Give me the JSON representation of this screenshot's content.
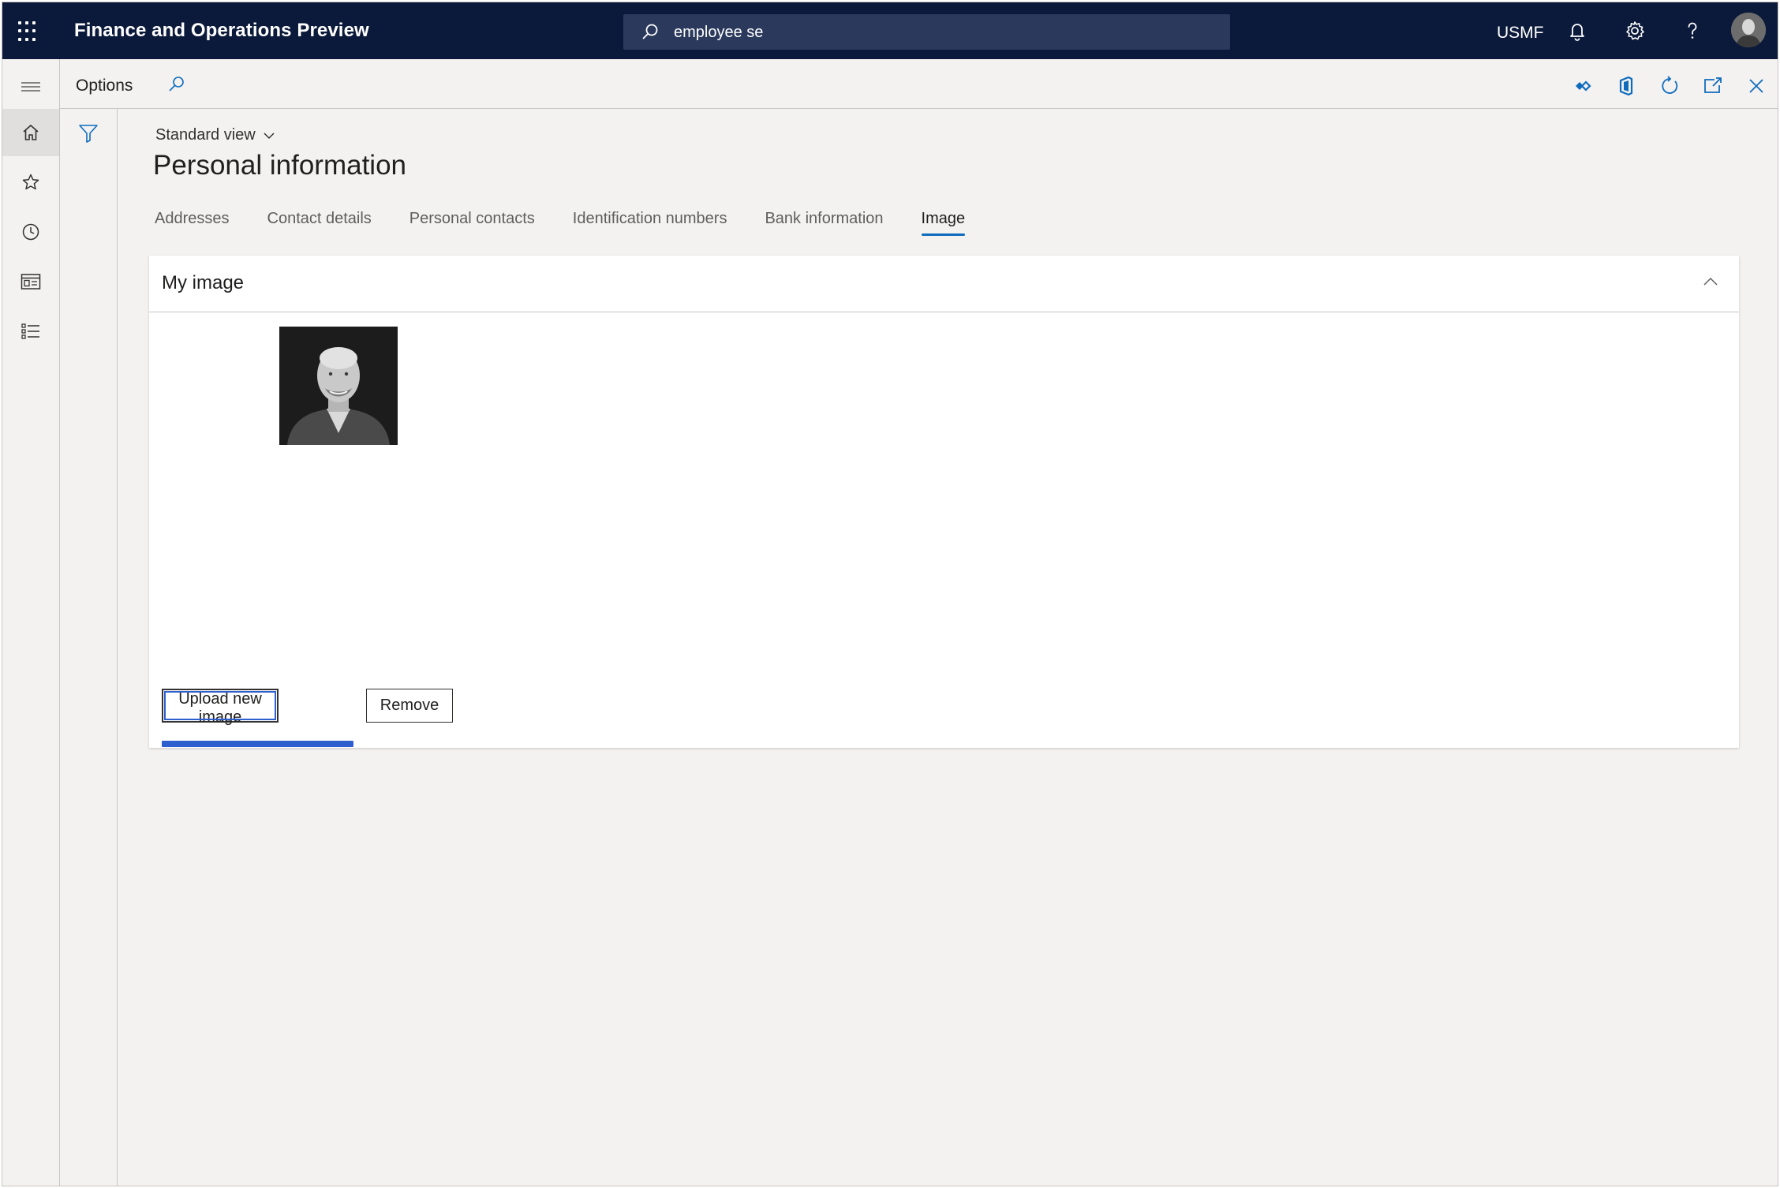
{
  "app": {
    "title": "Finance and Operations Preview"
  },
  "search": {
    "value": "employee se"
  },
  "topbar": {
    "company": "USMF"
  },
  "actionbar": {
    "options_label": "Options"
  },
  "view": {
    "label": "Standard view"
  },
  "page": {
    "title": "Personal information"
  },
  "tabs": [
    {
      "label": "Addresses",
      "active": false
    },
    {
      "label": "Contact details",
      "active": false
    },
    {
      "label": "Personal contacts",
      "active": false
    },
    {
      "label": "Identification numbers",
      "active": false
    },
    {
      "label": "Bank information",
      "active": false
    },
    {
      "label": "Image",
      "active": true
    }
  ],
  "card": {
    "title": "My image",
    "upload_label": "Upload new image",
    "remove_label": "Remove"
  },
  "icons": {
    "waffle": "app-launcher-icon",
    "search": "search-icon",
    "bell": "notifications-bell-icon",
    "gear": "settings-gear-icon",
    "help": "help-question-icon",
    "home": "home-icon",
    "star": "favorites-star-icon",
    "clock": "recent-clock-icon",
    "workspace": "workspaces-icon",
    "modules": "modules-list-icon"
  },
  "colors": {
    "topbar": "#0b1a3a",
    "accent": "#0f6cbd",
    "upload_progress": "#2f5fcf"
  }
}
